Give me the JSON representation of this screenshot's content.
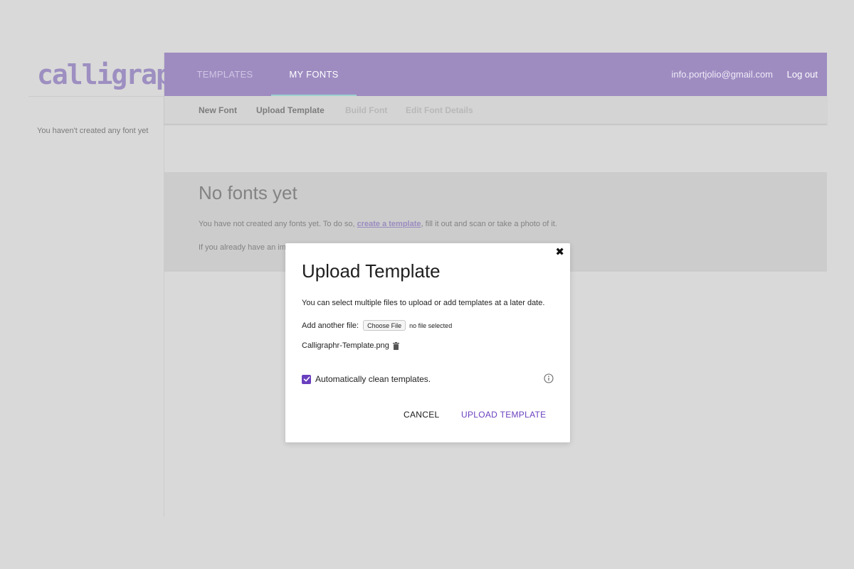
{
  "brand": {
    "logo_text": "calligraphr"
  },
  "sidebar": {
    "empty_text": "You haven't created any font yet"
  },
  "topbar": {
    "tabs": [
      {
        "label": "TEMPLATES"
      },
      {
        "label": "MY FONTS"
      }
    ],
    "active_tab": "MY FONTS",
    "user_email": "info.portjolio@gmail.com",
    "logout_label": "Log out"
  },
  "subnav": {
    "items": [
      {
        "label": "New Font"
      },
      {
        "label": "Upload Template"
      },
      {
        "label": "Build Font"
      },
      {
        "label": "Edit Font Details"
      }
    ]
  },
  "main": {
    "title": "No fonts yet",
    "para1_before": "You have not created any fonts yet. To do so, ",
    "para1_link": "create a template",
    "para1_after": ", fill it out and scan or take a photo of it.",
    "para2": "If you already have an im"
  },
  "modal": {
    "title": "Upload Template",
    "description": "You can select multiple files to upload or add templates at a later date.",
    "add_file_label": "Add another file:",
    "choose_file_label": "Choose File",
    "no_file_text": "no file selected",
    "uploaded_file": "Calligraphr-Template.png",
    "auto_clean_label": "Automatically clean templates.",
    "auto_clean_checked": true,
    "cancel_label": "CANCEL",
    "upload_label": "UPLOAD TEMPLATE",
    "close_glyph": "✖"
  },
  "colors": {
    "brand_purple": "#9e8cc1",
    "accent_purple": "#6a3fbf",
    "tab_indicator": "#9fd3d1"
  }
}
